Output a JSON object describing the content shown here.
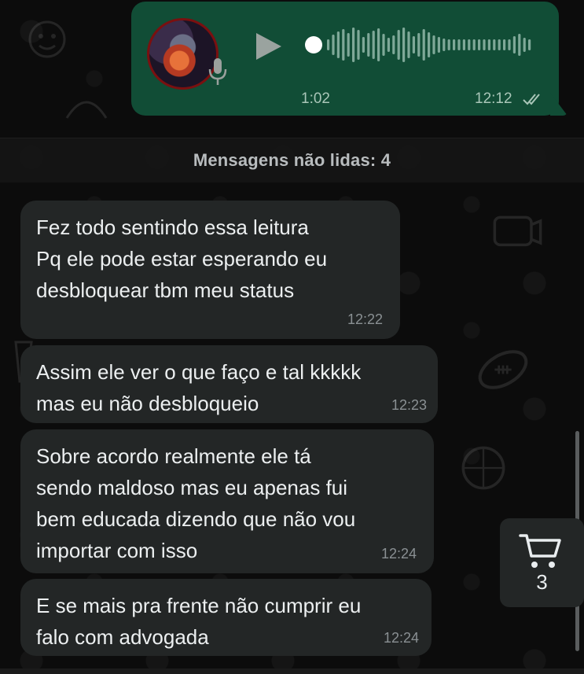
{
  "voice_message": {
    "duration": "1:02",
    "time": "12:12",
    "status_icon": "double-check-icon",
    "play_icon": "play-icon",
    "mic_icon": "mic-icon",
    "bubble_color": "#114d36"
  },
  "unread_divider": {
    "label": "Mensagens não lidas: 4"
  },
  "messages": [
    {
      "text": "Fez todo sentindo essa leitura\nPq ele pode estar esperando eu\ndesbloquear tbm meu status",
      "time": "12:22"
    },
    {
      "text": "Assim ele ver o que faço e tal kkkkk\nmas eu não desbloqueio",
      "time": "12:23"
    },
    {
      "text": "Sobre acordo realmente ele tá\nsendo maldoso mas eu apenas fui\nbem educada dizendo que não vou\nimportar com isso",
      "time": "12:24"
    },
    {
      "text": "E se mais pra frente não cumprir eu\nfalo com advogada",
      "time": "12:24"
    }
  ],
  "cart": {
    "icon": "cart-icon",
    "count": "3"
  },
  "colors": {
    "incoming_bubble": "#232626",
    "background": "#0b0b0b"
  }
}
